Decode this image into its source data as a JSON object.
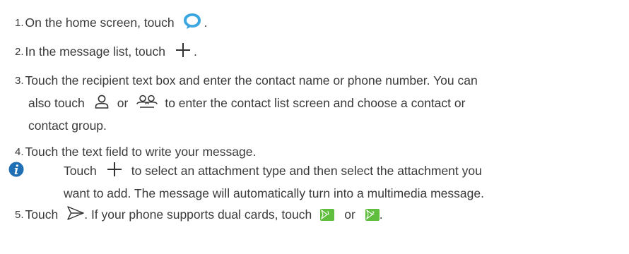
{
  "steps": [
    {
      "num": "1.",
      "before": "On the home screen, touch",
      "after": ".",
      "icon": "messaging-app-icon"
    },
    {
      "num": "2.",
      "before": "In the message list, touch",
      "after": ".",
      "icon": "plus-icon"
    },
    {
      "num": "3.",
      "line1": "Touch the recipient text box and enter the contact name or phone number. You can",
      "line2_before": "also touch",
      "line2_or": "or",
      "line2_after": "to enter the contact list screen and choose a contact or",
      "line3": "contact group.",
      "icons": [
        "person-icon",
        "contact-group-icon"
      ]
    },
    {
      "num": "4.",
      "text": "Touch the text field to write your message."
    },
    {
      "num": "5.",
      "before": "Touch",
      "mid": ". If your phone supports dual cards, touch",
      "or": "or",
      "after": ".",
      "icons": [
        "send-icon",
        "sim1-send-icon",
        "sim2-send-icon"
      ],
      "sim_slots": [
        "1",
        "2"
      ]
    }
  ],
  "note": {
    "icon": "info-icon",
    "before": "Touch",
    "after": "to select an attachment type and then select the attachment you",
    "line2": "want to add. The message will automatically turn into a multimedia message."
  },
  "colors": {
    "text": "#3a3a3a",
    "accent_blue": "#1f6fb5",
    "message_icon": "#3ca6e0",
    "sim_green": "#5fbe3e"
  }
}
